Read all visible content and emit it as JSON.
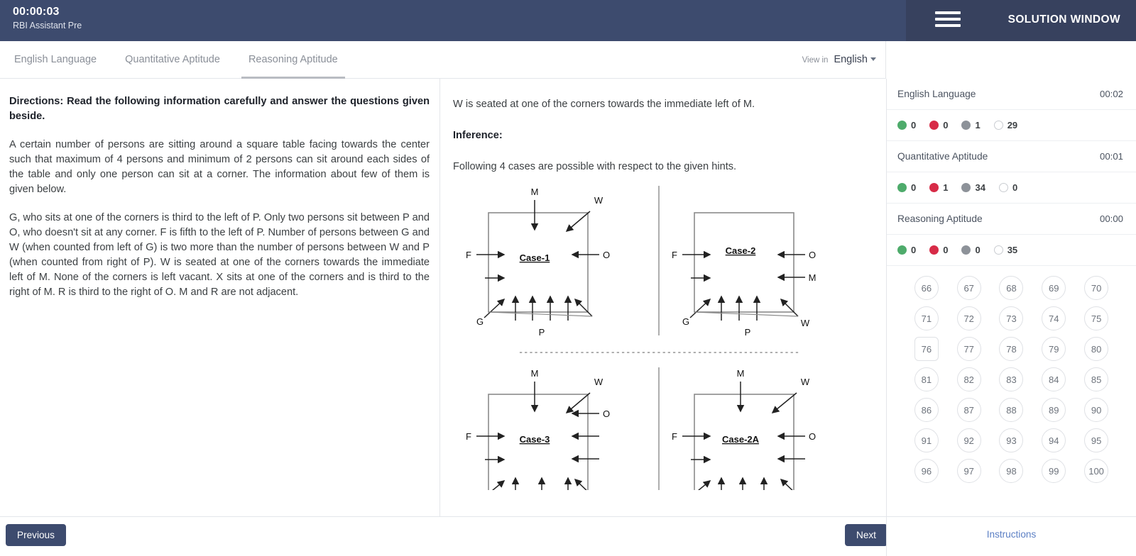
{
  "header": {
    "timer": "00:00:03",
    "exam_name": "RBI Assistant Pre",
    "menu_icon": "hamburger-menu-icon",
    "solution_window_title": "SOLUTION WINDOW"
  },
  "tabbar": {
    "tabs": [
      {
        "label": "English Language",
        "active": false
      },
      {
        "label": "Quantitative Aptitude",
        "active": false
      },
      {
        "label": "Reasoning Aptitude",
        "active": true
      }
    ],
    "view_in_label": "View in",
    "view_in_value": "English",
    "caret_icon": "chevron-down-icon"
  },
  "passage": {
    "directions": "Directions: Read the following information carefully and answer the questions given beside.",
    "para1": "A certain number of persons are sitting around a square table facing towards the center such that maximum of 4 persons and minimum of 2 persons can sit around each sides of the table and only one person can sit at a corner. The information about few of them is given below.",
    "para2": "G, who sits at one of the corners is third to the left of P. Only two persons sit between P and O, who doesn't sit at any corner. F is fifth to the left of P. Number of persons between G and W (when counted from left of G) is two more than the number of persons between W and P (when counted from right of P). W is seated at one of the corners towards the immediate left of M. None of the corners is left vacant. X sits at one of the corners and is third to the right of M. R is third to the right of O. M and R are not adjacent."
  },
  "solution": {
    "hint_line": "W is seated at one of the corners towards the immediate left of M.",
    "inference_label": "Inference:",
    "inference_text": "Following 4 cases are possible with respect to the given hints.",
    "separator": "-------------------------------------------------------",
    "cases": [
      {
        "title": "Case-1",
        "labels": {
          "top": "M",
          "top_right": "W",
          "left": "F",
          "right": "O",
          "bottom_left": "G",
          "bottom": "P"
        }
      },
      {
        "title": "Case-2",
        "labels": {
          "left": "F",
          "right_top": "O",
          "right_bottom": "M",
          "bottom_left": "G",
          "bottom": "P",
          "bottom_right": "W"
        }
      },
      {
        "title": "Case-3",
        "labels": {
          "top": "M",
          "top_right": "W",
          "left": "F",
          "right": "O"
        }
      },
      {
        "title": "Case-2A",
        "labels": {
          "top": "M",
          "top_right": "W",
          "left": "F",
          "right": "O"
        }
      }
    ]
  },
  "sidebar": {
    "sections": [
      {
        "name": "English Language",
        "time": "00:02",
        "stats": [
          {
            "status": "answered",
            "color": "#4eab6b",
            "count": "0"
          },
          {
            "status": "not-answered",
            "color": "#d72b47",
            "count": "0"
          },
          {
            "status": "marked",
            "color": "#8d9299",
            "count": "1"
          },
          {
            "status": "not-visited",
            "color": "#ffffff",
            "count": "29"
          }
        ]
      },
      {
        "name": "Quantitative Aptitude",
        "time": "00:01",
        "stats": [
          {
            "status": "answered",
            "color": "#4eab6b",
            "count": "0"
          },
          {
            "status": "not-answered",
            "color": "#d72b47",
            "count": "1"
          },
          {
            "status": "marked",
            "color": "#8d9299",
            "count": "34"
          },
          {
            "status": "not-visited",
            "color": "#ffffff",
            "count": "0"
          }
        ]
      },
      {
        "name": "Reasoning Aptitude",
        "time": "00:00",
        "stats": [
          {
            "status": "answered",
            "color": "#4eab6b",
            "count": "0"
          },
          {
            "status": "not-answered",
            "color": "#d72b47",
            "count": "0"
          },
          {
            "status": "marked",
            "color": "#8d9299",
            "count": "0"
          },
          {
            "status": "not-visited",
            "color": "#ffffff",
            "count": "35"
          }
        ]
      }
    ],
    "question_numbers": [
      "66",
      "67",
      "68",
      "69",
      "70",
      "71",
      "72",
      "73",
      "74",
      "75",
      "76",
      "77",
      "78",
      "79",
      "80",
      "81",
      "82",
      "83",
      "84",
      "85",
      "86",
      "87",
      "88",
      "89",
      "90",
      "91",
      "92",
      "93",
      "94",
      "95",
      "96",
      "97",
      "98",
      "99",
      "100"
    ],
    "current_question": "76"
  },
  "footer": {
    "previous_label": "Previous",
    "next_label": "Next",
    "instructions_label": "Instructions"
  }
}
